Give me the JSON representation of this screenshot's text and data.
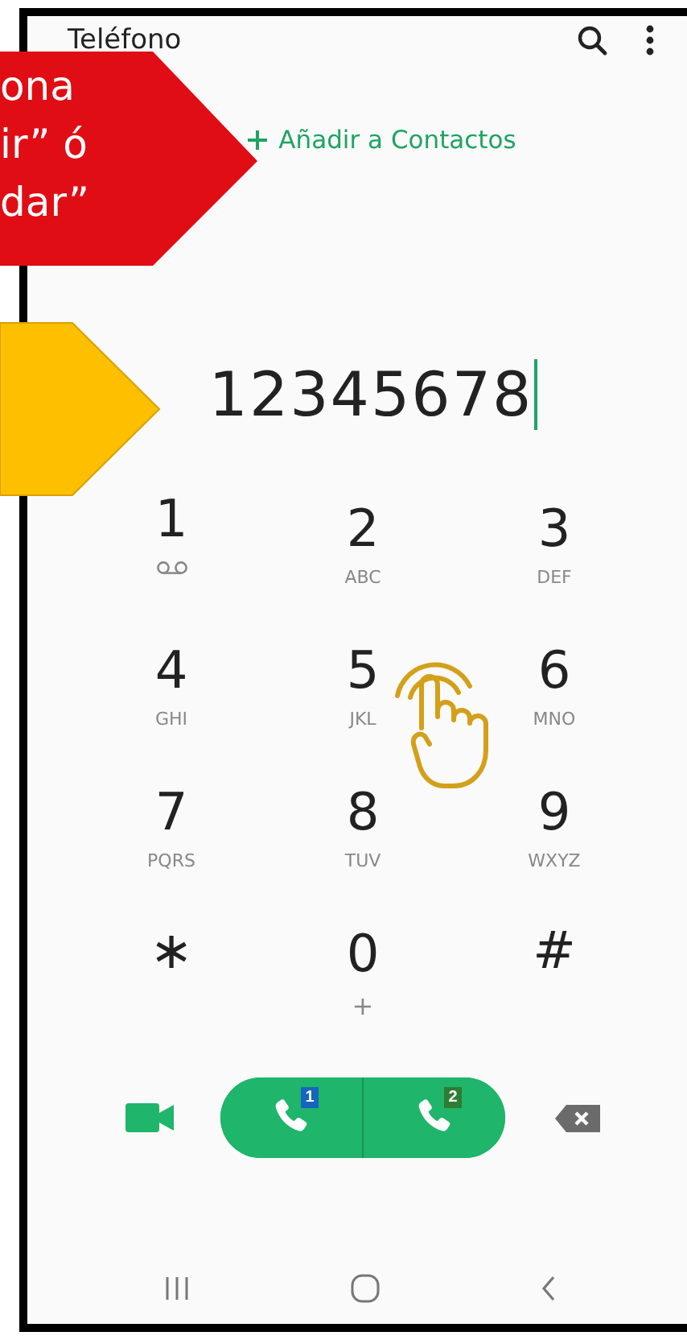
{
  "app_bar": {
    "title": "Teléfono"
  },
  "add_contact": {
    "label": "Añadir a Contactos"
  },
  "dialed_number": "12345678",
  "keys": [
    {
      "kind": "voicemail",
      "digit": "1"
    },
    {
      "kind": "letters",
      "digit": "2",
      "letters": "ABC"
    },
    {
      "kind": "letters",
      "digit": "3",
      "letters": "DEF"
    },
    {
      "kind": "letters",
      "digit": "4",
      "letters": "GHI"
    },
    {
      "kind": "letters",
      "digit": "5",
      "letters": "JKL"
    },
    {
      "kind": "letters",
      "digit": "6",
      "letters": "MNO"
    },
    {
      "kind": "letters",
      "digit": "7",
      "letters": "PQRS"
    },
    {
      "kind": "letters",
      "digit": "8",
      "letters": "TUV"
    },
    {
      "kind": "letters",
      "digit": "9",
      "letters": "WXYZ"
    },
    {
      "kind": "symbol",
      "digit": "∗"
    },
    {
      "kind": "letters",
      "digit": "0",
      "letters": "+"
    },
    {
      "kind": "symbol",
      "digit": "#"
    }
  ],
  "call_buttons": [
    {
      "sim": "1",
      "color": "#1565c0"
    },
    {
      "sim": "2",
      "color": "#2e7d32"
    }
  ],
  "callout": {
    "lines": [
      "ona",
      "ir” ó",
      "dar”"
    ]
  }
}
